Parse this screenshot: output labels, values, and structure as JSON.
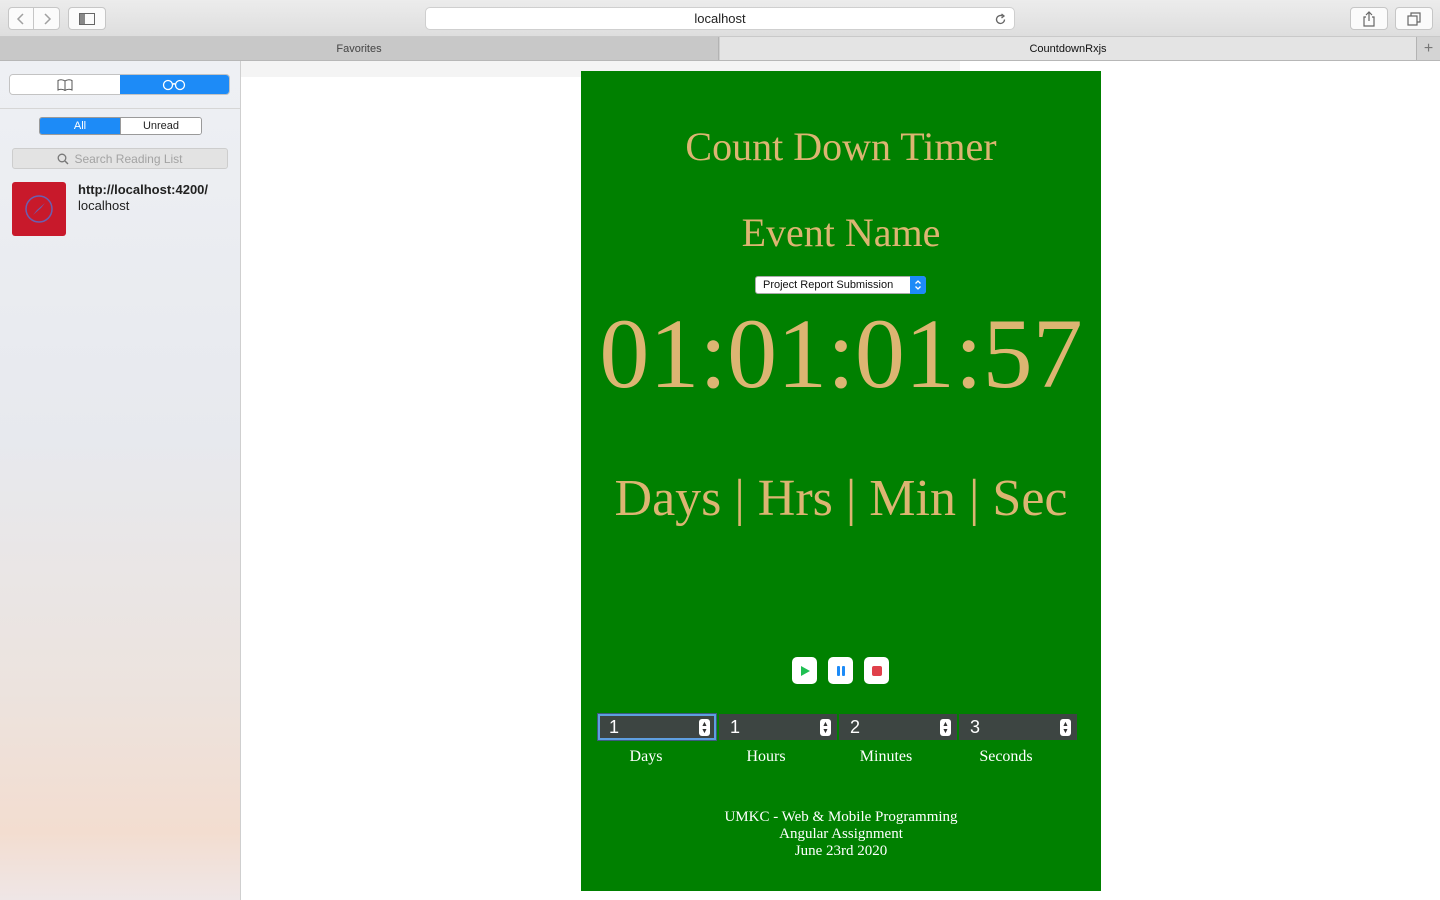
{
  "browser": {
    "address": "localhost",
    "tabs": [
      {
        "label": "Favorites",
        "active": false
      },
      {
        "label": "CountdownRxjs",
        "active": true
      }
    ],
    "new_tab_label": "+"
  },
  "sidebar": {
    "filters": [
      "All",
      "Unread"
    ],
    "active_filter": "All",
    "search_placeholder": "Search Reading List",
    "items": [
      {
        "url": "http://localhost:4200/",
        "host": "localhost"
      }
    ]
  },
  "app": {
    "title": "Count Down Timer",
    "event_label": "Event Name",
    "event_selected": "Project Report Submission",
    "timer": "01:01:01:57",
    "units": "Days | Hrs | Min | Sec",
    "controls": [
      "play",
      "pause",
      "stop"
    ],
    "fields": [
      {
        "label": "Days",
        "value": "1"
      },
      {
        "label": "Hours",
        "value": "1"
      },
      {
        "label": "Minutes",
        "value": "2"
      },
      {
        "label": "Seconds",
        "value": "3"
      }
    ],
    "footer": [
      "UMKC - Web & Mobile Programming",
      "Angular Assignment",
      "June 23rd 2020"
    ]
  },
  "colors": {
    "panel_bg": "#008000",
    "accent_text": "#dcb572",
    "safari_blue": "#1d8bf7",
    "play": "#1fbf52",
    "pause": "#1d8bf7",
    "stop": "#e0404a"
  }
}
